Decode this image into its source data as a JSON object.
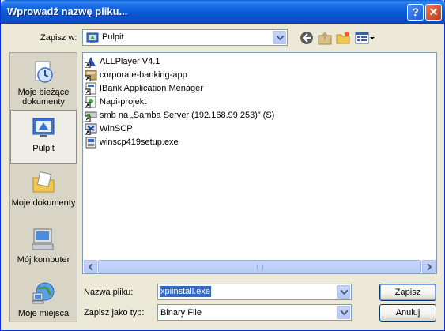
{
  "window": {
    "title": "Wprowadź nazwę pliku..."
  },
  "toolbar": {
    "save_in_label": "Zapisz w:",
    "location": "Pulpit",
    "back_icon": "back-arrow-icon",
    "up_icon": "up-folder-icon",
    "new_folder_icon": "new-folder-icon",
    "views_icon": "views-menu-icon"
  },
  "places": [
    {
      "label": "Moje bieżące dokumenty",
      "icon": "recent-documents-icon",
      "selected": false
    },
    {
      "label": "Pulpit",
      "icon": "desktop-icon",
      "selected": true
    },
    {
      "label": "Moje dokumenty",
      "icon": "my-documents-icon",
      "selected": false
    },
    {
      "label": "Mój komputer",
      "icon": "my-computer-icon",
      "selected": false
    },
    {
      "label": "Moje miejsca",
      "icon": "network-places-icon",
      "selected": false
    }
  ],
  "files": [
    {
      "name": "ALLPlayer V4.1",
      "icon": "shortcut-icon"
    },
    {
      "name": "corporate-banking-app",
      "icon": "shortcut-icon"
    },
    {
      "name": "IBank Application Menager",
      "icon": "shortcut-icon"
    },
    {
      "name": "Napi-projekt",
      "icon": "shortcut-icon"
    },
    {
      "name": "smb na „Samba Server (192.168.99.253)” (S)",
      "icon": "network-drive-shortcut-icon"
    },
    {
      "name": "WinSCP",
      "icon": "shortcut-icon"
    },
    {
      "name": "winscp419setup.exe",
      "icon": "installer-icon"
    }
  ],
  "form": {
    "filename_label": "Nazwa pliku:",
    "filename_value": "xpiinstall.exe",
    "filetype_label": "Zapisz jako typ:",
    "filetype_value": "Binary File"
  },
  "buttons": {
    "save": "Zapisz",
    "cancel": "Anuluj"
  },
  "colors": {
    "titlebar": "#0a4fc9",
    "selection": "#316ac5",
    "face": "#ece9d8"
  }
}
